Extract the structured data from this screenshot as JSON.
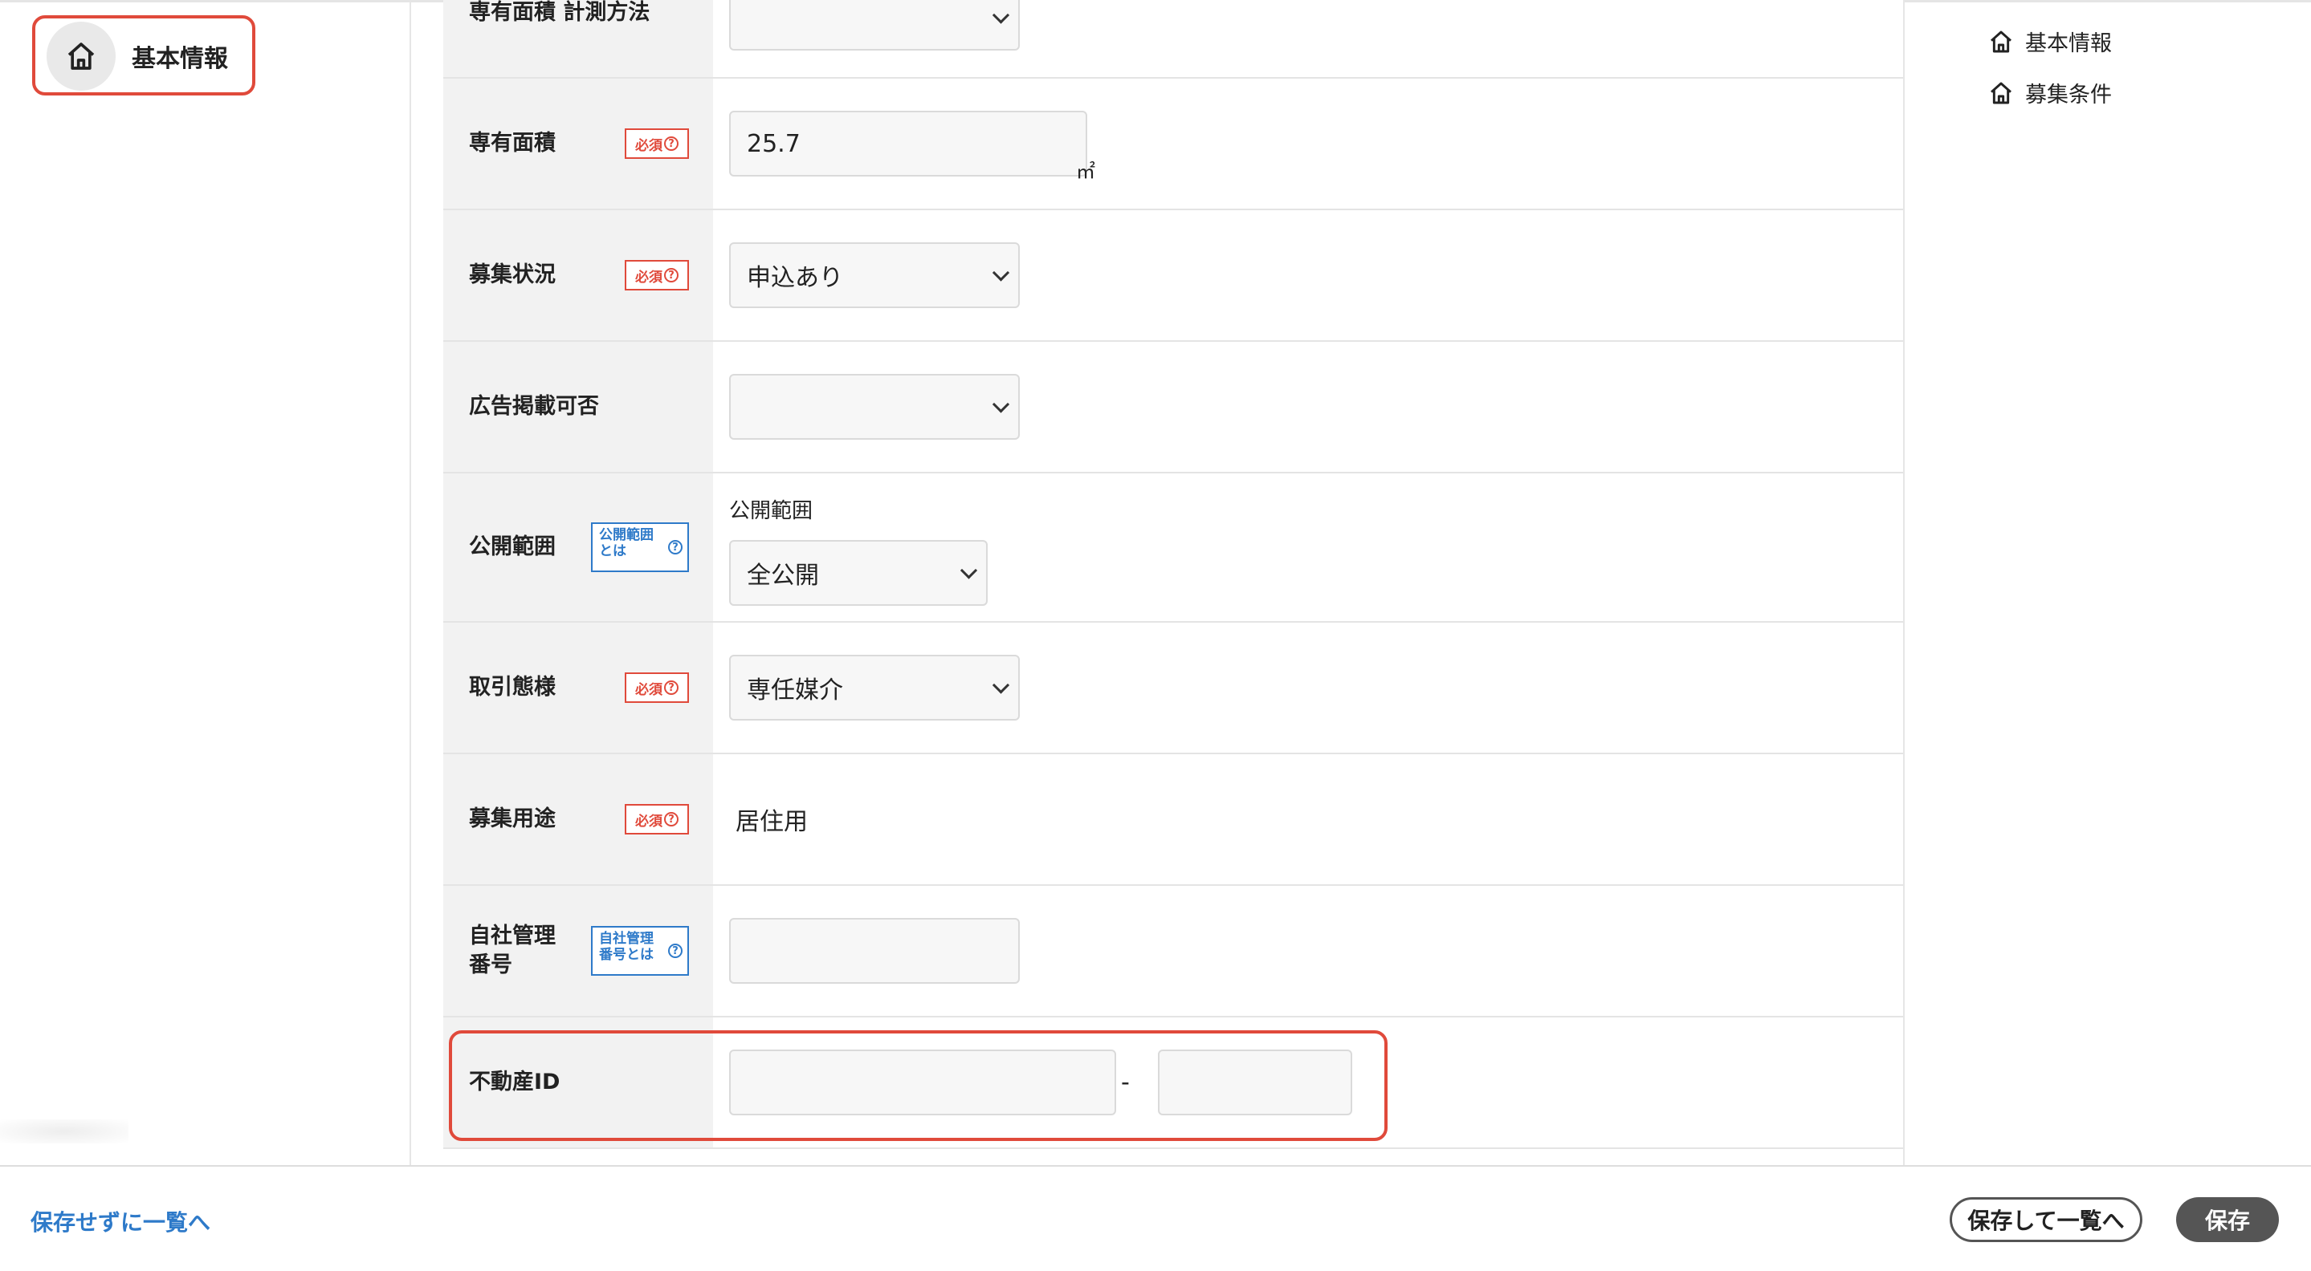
{
  "nav": {
    "home_label": "基本情報"
  },
  "form": {
    "area_method": {
      "label": "専有面積 計測方法",
      "value": ""
    },
    "area": {
      "label": "専有面積",
      "required": "必須",
      "value": "25.7",
      "unit": "㎡"
    },
    "status": {
      "label": "募集状況",
      "required": "必須",
      "value": "申込あり"
    },
    "ad": {
      "label": "広告掲載可否",
      "value": ""
    },
    "visibility": {
      "label": "公開範囲",
      "info": "公開範囲とは",
      "sub_label": "公開範囲",
      "value": "全公開"
    },
    "transaction": {
      "label": "取引態様",
      "required": "必須",
      "value": "専任媒介"
    },
    "usage": {
      "label": "募集用途",
      "required": "必須",
      "value": "居住用"
    },
    "mgmt_no": {
      "label": "自社管理番号",
      "info": "自社管理番号とは",
      "value": ""
    },
    "property_id": {
      "label": "不動産ID",
      "separator": "-",
      "value1": "",
      "value2": ""
    }
  },
  "toc": {
    "items": [
      "基本情報",
      "募集条件"
    ]
  },
  "footer": {
    "cancel": "保存せずに一覧へ",
    "save_list": "保存して一覧へ",
    "save": "保存"
  },
  "colors": {
    "required": "#e04a3b",
    "info": "#2e7ac9",
    "highlight": "#e04a3b",
    "link": "#2e7ac9",
    "save_button": "#555555"
  },
  "icons": {
    "home": "home-icon",
    "help": "question-circle-icon",
    "dropdown": "chevron-down-icon"
  }
}
